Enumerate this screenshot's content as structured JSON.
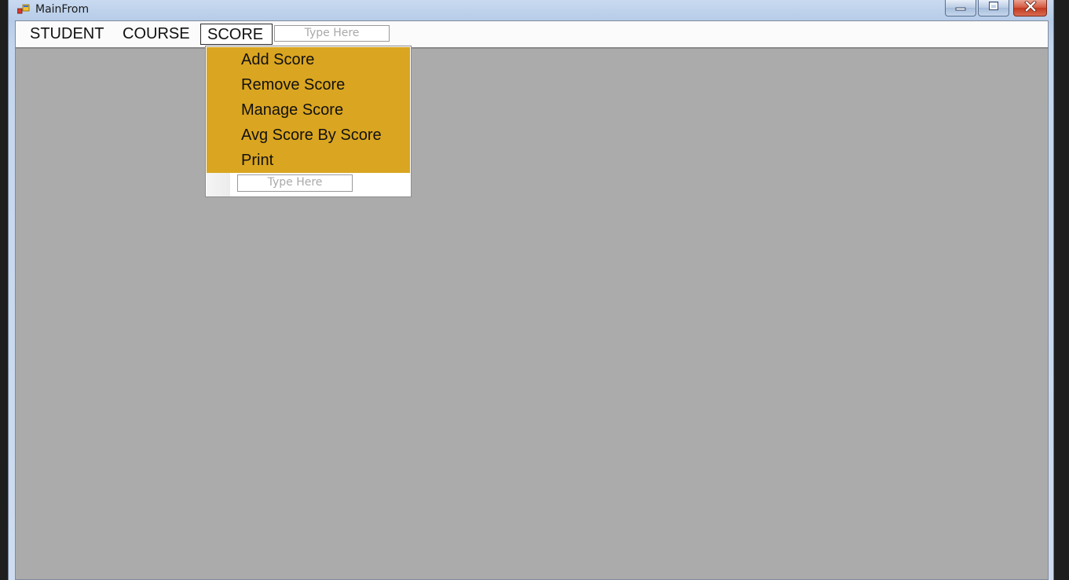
{
  "window": {
    "title": "MainFrom"
  },
  "menubar": {
    "items": [
      {
        "label": "STUDENT"
      },
      {
        "label": "COURSE"
      },
      {
        "label": "SCORE"
      }
    ],
    "type_here": "Type Here"
  },
  "dropdown": {
    "items": [
      {
        "label": "Add Score"
      },
      {
        "label": "Remove Score"
      },
      {
        "label": "Manage Score"
      },
      {
        "label": "Avg Score By Score"
      },
      {
        "label": "Print"
      }
    ],
    "type_here": "Type Here",
    "highlight_color": "#daa520"
  },
  "colors": {
    "mdi_background": "#ababab",
    "menu_highlight": "#daa520"
  },
  "icons": {
    "app": "app-form-icon",
    "minimize": "minimize-icon",
    "maximize": "maximize-icon",
    "close": "close-icon"
  }
}
